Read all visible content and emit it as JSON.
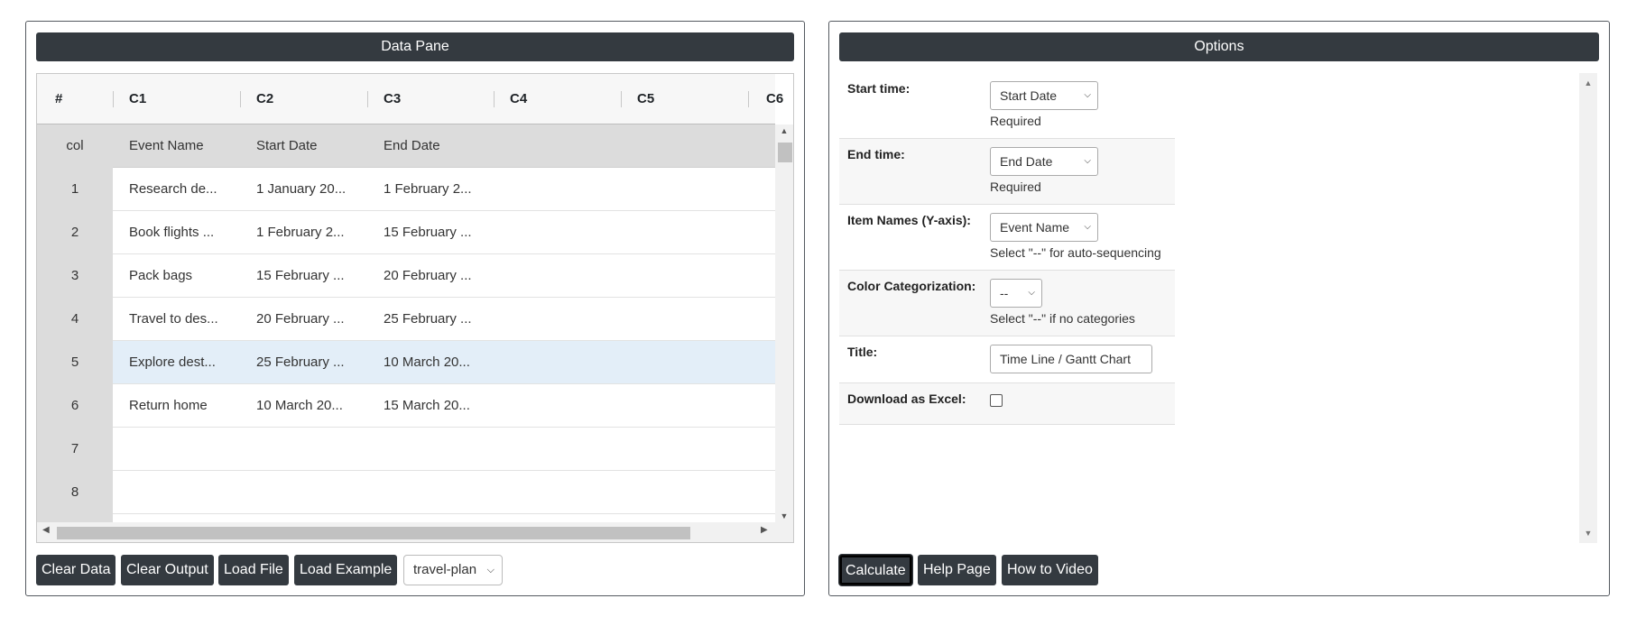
{
  "data_pane": {
    "title": "Data Pane",
    "columns": [
      "#",
      "C1",
      "C2",
      "C3",
      "C4",
      "C5",
      "C6"
    ],
    "header_row": {
      "index": "col",
      "cells": [
        "Event Name",
        "Start Date",
        "End Date"
      ]
    },
    "rows": [
      {
        "index": "1",
        "cells": [
          "Research de...",
          "1 January 20...",
          "1 February 2..."
        ]
      },
      {
        "index": "2",
        "cells": [
          "Book flights ...",
          "1 February 2...",
          "15 February ..."
        ]
      },
      {
        "index": "3",
        "cells": [
          "Pack bags",
          "15 February ...",
          "20 February ..."
        ]
      },
      {
        "index": "4",
        "cells": [
          "Travel to des...",
          "20 February ...",
          "25 February ..."
        ]
      },
      {
        "index": "5",
        "cells": [
          "Explore dest...",
          "25 February ...",
          "10 March 20..."
        ]
      },
      {
        "index": "6",
        "cells": [
          "Return home",
          "10 March 20...",
          "15 March 20..."
        ]
      },
      {
        "index": "7",
        "cells": [
          "",
          "",
          ""
        ]
      },
      {
        "index": "8",
        "cells": [
          "",
          "",
          ""
        ]
      }
    ],
    "selected_row": "5",
    "buttons": {
      "clear_data": "Clear Data",
      "clear_output": "Clear Output",
      "load_file": "Load File",
      "load_example": "Load Example"
    },
    "example_select": "travel-plan"
  },
  "options": {
    "title": "Options",
    "start_time": {
      "label": "Start time:",
      "value": "Start Date",
      "help": "Required"
    },
    "end_time": {
      "label": "End time:",
      "value": "End Date",
      "help": "Required"
    },
    "item_names": {
      "label": "Item Names (Y-axis):",
      "value": "Event Name",
      "help": "Select \"--\" for auto-sequencing"
    },
    "color_cat": {
      "label": "Color Categorization:",
      "value": "--",
      "help": "Select \"--\" if no categories"
    },
    "title_field": {
      "label": "Title:",
      "value": "Time Line / Gantt Chart"
    },
    "download_excel": {
      "label": "Download as Excel:",
      "checked": false
    },
    "buttons": {
      "calculate": "Calculate",
      "help_page": "Help Page",
      "how_to_video": "How to Video"
    }
  },
  "icons": {
    "chevron": "chevron-down-icon",
    "scroll_up": "arrow-up-icon",
    "scroll_down": "arrow-down-icon",
    "scroll_left": "arrow-left-icon",
    "scroll_right": "arrow-right-icon"
  },
  "colors": {
    "header_bg": "#343a40",
    "selected_row": "#e3eef8",
    "index_col": "#dcdcdc"
  }
}
